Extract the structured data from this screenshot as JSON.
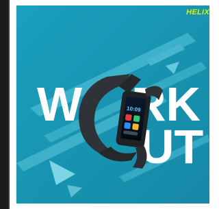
{
  "brand": {
    "text": "HELIX"
  },
  "headline": {
    "line1_left": "W",
    "line1_right": "RK",
    "line2_right": "UT"
  },
  "watch": {
    "screen_time": "10:09"
  },
  "colors": {
    "background_teal": "#1797b4",
    "stripe_light": "#5cc8de",
    "text_white": "#ffffff",
    "brand_yellow": "#d8f000",
    "band_dark": "#2f3337"
  }
}
